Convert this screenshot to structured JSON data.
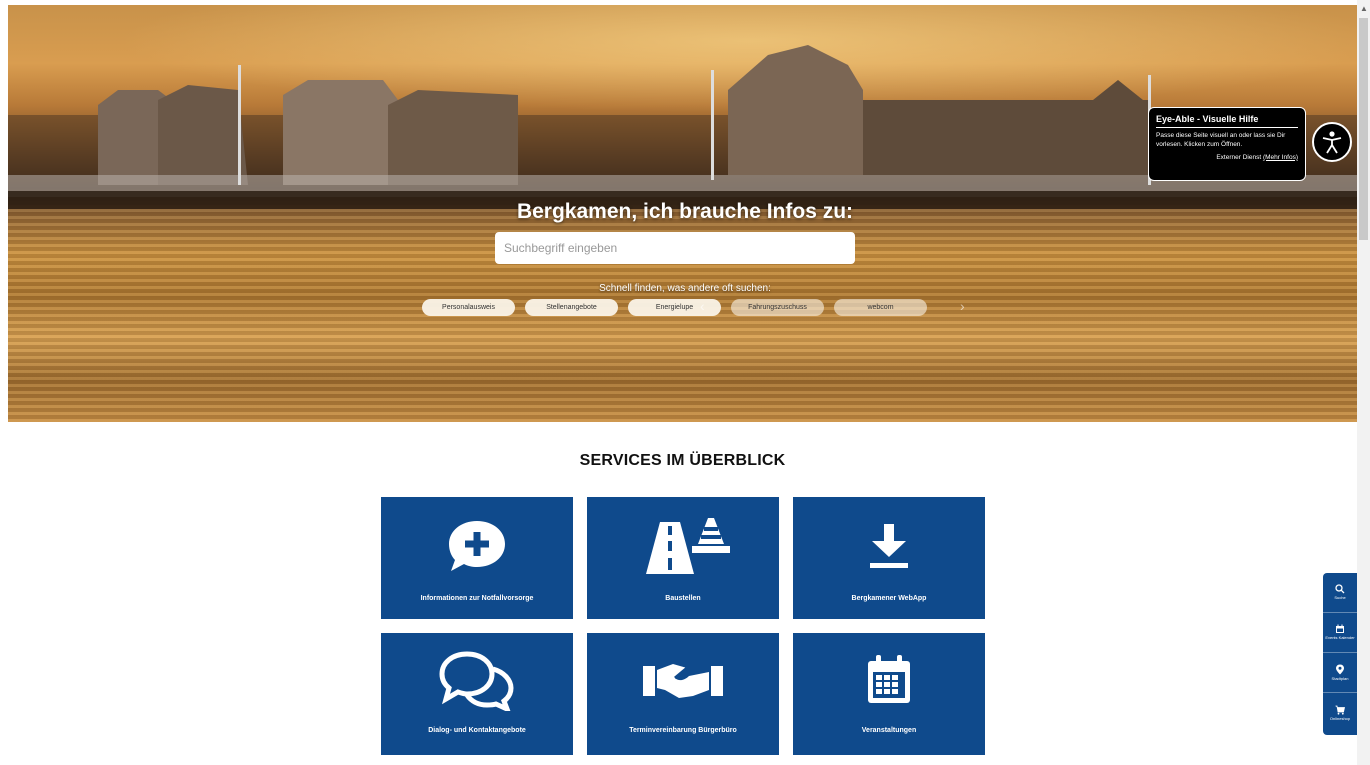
{
  "hero": {
    "title": "Bergkamen, ich brauche Infos zu:",
    "search_placeholder": "Suchbegriff eingeben",
    "quick_caption": "Schnell finden, was andere oft suchen:",
    "quick_links": [
      "Personalausweis",
      "Stellenangebote",
      "Energielupe",
      "Fahrungszuschuss",
      "webcom"
    ]
  },
  "eyeable": {
    "title": "Eye-Able - Visuelle Hilfe",
    "description": "Passe diese Seite visuell an oder lass sie Dir vorlesen. Klicken zum Öffnen.",
    "external_prefix": "Externer Dienst",
    "more_info": "(Mehr Infos)"
  },
  "services": {
    "title": "SERVICES IM ÜBERBLICK",
    "tiles": [
      {
        "label": "Informationen zur Notfallvorsorge",
        "icon": "chat-plus-icon"
      },
      {
        "label": "Baustellen",
        "icon": "road-cone-icon"
      },
      {
        "label": "Bergkamener WebApp",
        "icon": "download-icon"
      },
      {
        "label": "Dialog- und Kontaktangebote",
        "icon": "chat-bubbles-icon"
      },
      {
        "label": "Terminvereinbarung Bürgerbüro",
        "icon": "handshake-icon"
      },
      {
        "label": "Veranstaltungen",
        "icon": "calendar-icon"
      }
    ]
  },
  "sidebar": {
    "items": [
      {
        "label": "Suche",
        "icon": "search-icon"
      },
      {
        "label": "Events Kalender",
        "icon": "calendar-icon"
      },
      {
        "label": "Stadtplan",
        "icon": "map-pin-icon"
      },
      {
        "label": "Onlineshop",
        "icon": "cart-icon"
      }
    ]
  },
  "colors": {
    "brand_blue": "#0f4a8c"
  }
}
